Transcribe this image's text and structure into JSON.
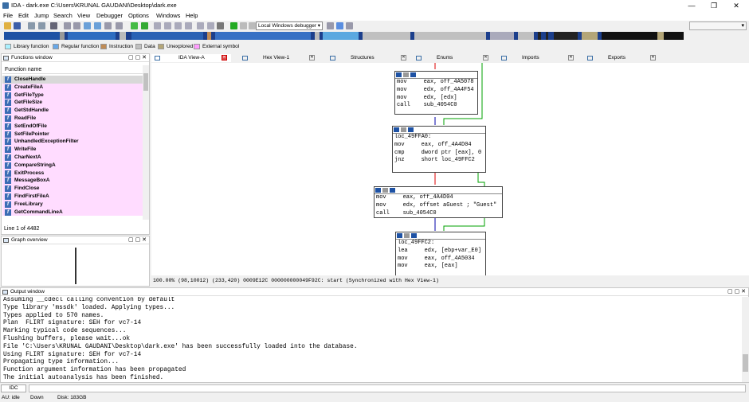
{
  "window": {
    "title": "IDA - dark.exe C:\\Users\\KRUNAL GAUDANI\\Desktop\\dark.exe",
    "min": "—",
    "max": "❐",
    "close": "✕"
  },
  "menu": [
    "File",
    "Edit",
    "Jump",
    "Search",
    "View",
    "Debugger",
    "Options",
    "Windows",
    "Help"
  ],
  "toolbar": {
    "debugger_select": "Local Windows debugger"
  },
  "legend": [
    {
      "label": "Library function",
      "color": "#aaf0ff"
    },
    {
      "label": "Regular function",
      "color": "#68a8e8"
    },
    {
      "label": "Instruction",
      "color": "#c08c56"
    },
    {
      "label": "Data",
      "color": "#c0c0c0"
    },
    {
      "label": "Unexplored",
      "color": "#b4a678"
    },
    {
      "label": "External symbol",
      "color": "#ff9cff"
    }
  ],
  "functions_window": {
    "title": "Functions window",
    "column": "Function name",
    "items": [
      "CloseHandle",
      "CreateFileA",
      "GetFileType",
      "GetFileSize",
      "GetStdHandle",
      "ReadFile",
      "SetEndOfFile",
      "SetFilePointer",
      "UnhandledExceptionFilter",
      "WriteFile",
      "CharNextA",
      "CompareStringA",
      "ExitProcess",
      "MessageBoxA",
      "FindClose",
      "FindFirstFileA",
      "FreeLibrary",
      "GetCommandLineA"
    ],
    "status": "Line 1 of 4482",
    "buttons": "▢ ▢ ✕"
  },
  "graph_overview": {
    "title": "Graph overview"
  },
  "tabs": [
    "IDA View-A",
    "Hex View-1",
    "Structures",
    "Enums",
    "Imports",
    "Exports"
  ],
  "graph": {
    "node1": [
      "mov     eax, off_4A5078",
      "mov     edx, off_4A4F54",
      "mov     edx, [edx]",
      "call    sub_4054C0"
    ],
    "node2": [
      "",
      "loc_49FFA0:",
      "mov     eax, off_4A4D04",
      "cmp     dword ptr [eax], 0",
      "jnz     short loc_49FFC2"
    ],
    "node3": [
      "mov     eax, off_4A4D04",
      "mov     edx, offset aGuest ; \"Guest\"",
      "call    sub_4054C0"
    ],
    "node4": [
      "",
      "loc_49FFC2:",
      "lea     edx, [ebp+var_E0]",
      "mov     eax, off_4A5034",
      "mov     eax, [eax]"
    ],
    "status": "100.00% (98,10012) (233,420) 0009E12C 000000000049F92C: start (Synchronized with Hex View-1)"
  },
  "output": {
    "title": "Output window",
    "lines": [
      "Assuming __cdecl calling convention by default",
      "Type library 'mssdk' loaded. Applying types...",
      "Types applied to 570 names.",
      "Plan  FLIRT signature: SEH for vc7-14",
      "Marking typical code sequences...",
      "Flushing buffers, please wait...ok",
      "File 'C:\\Users\\KRUNAL GAUDANI\\Desktop\\dark.exe' has been successfully loaded into the database.",
      "Using FLIRT signature: SEH for vc7-14",
      "Propagating type information...",
      "Function argument information has been propagated",
      "The initial autoanalysis has been finished."
    ],
    "idc": "IDC"
  },
  "statusbar": {
    "au": "AU:  idle",
    "dir": "Down",
    "disk": "Disk: 183GB"
  }
}
